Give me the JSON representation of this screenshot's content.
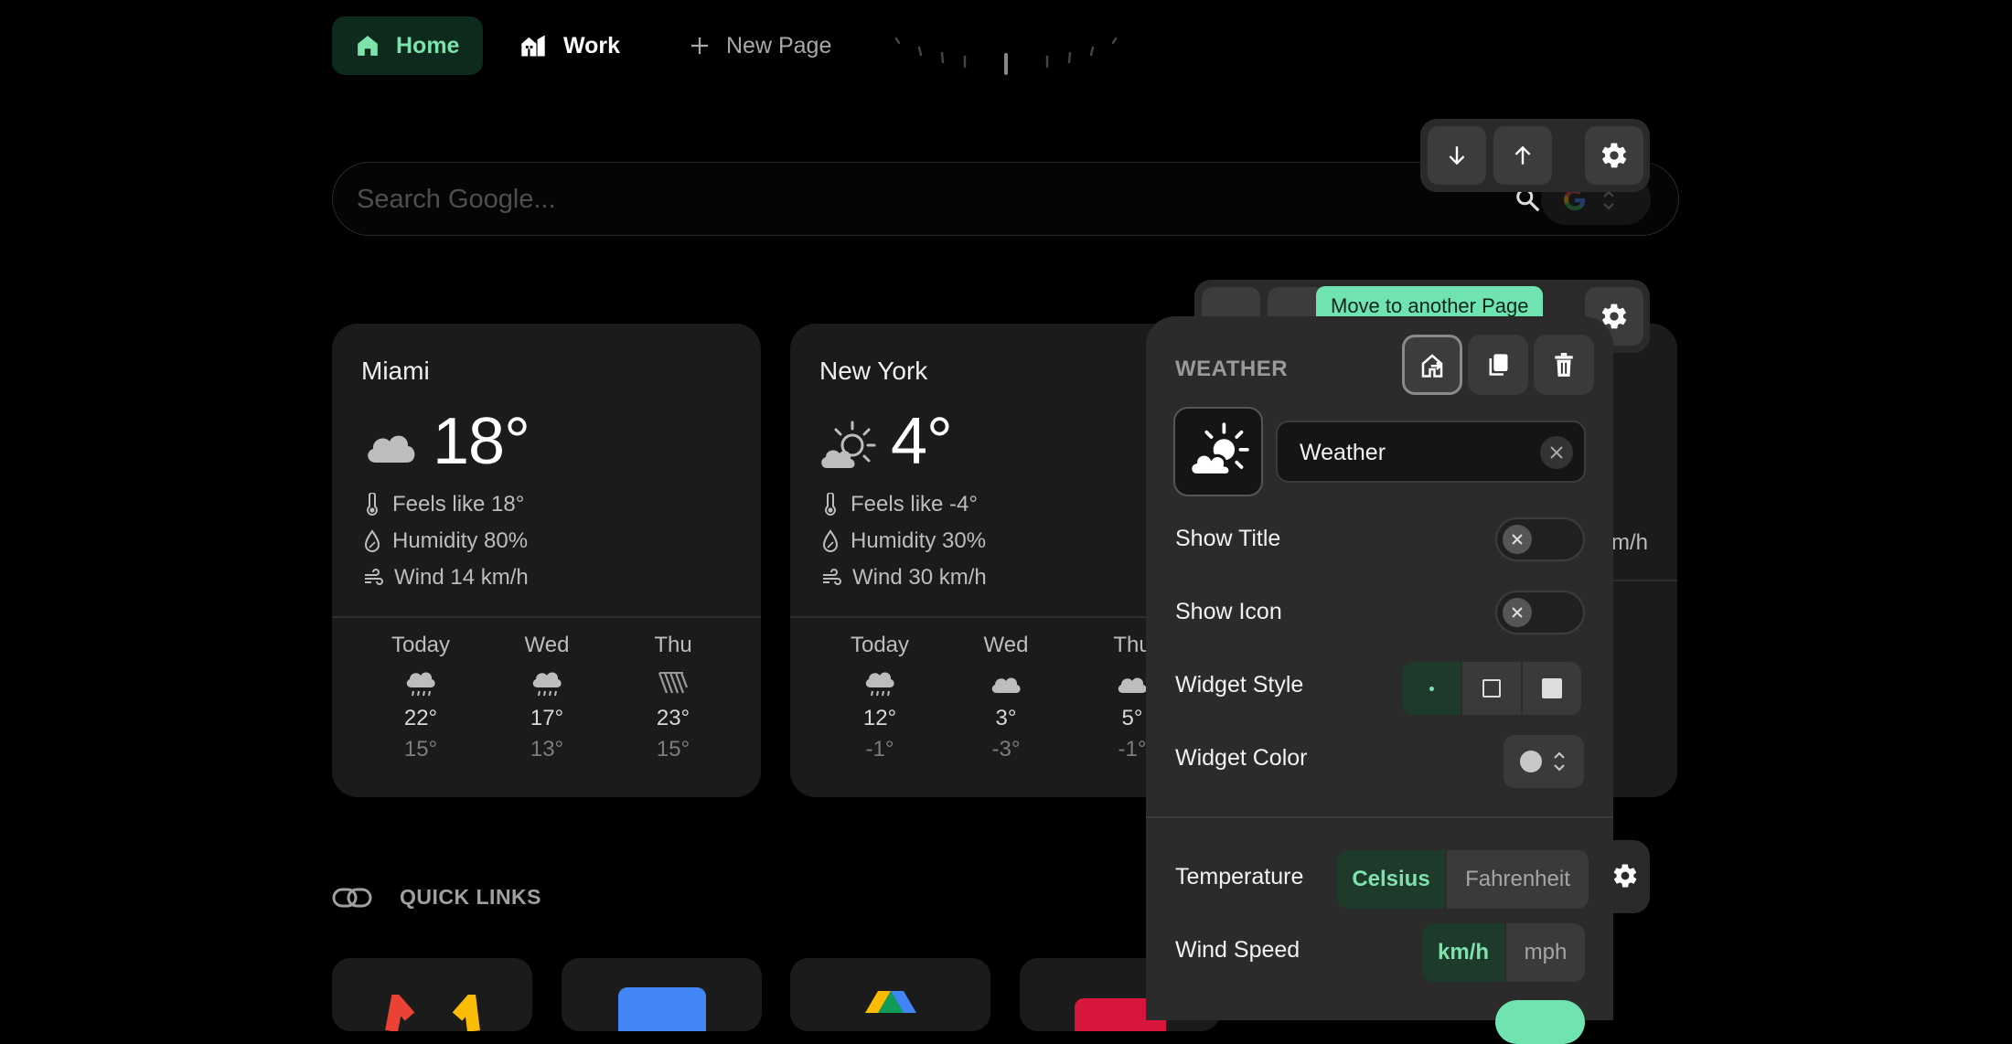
{
  "nav": {
    "tabs": [
      {
        "label": "Home",
        "icon": "home-icon"
      },
      {
        "label": "Work",
        "icon": "building-icon"
      },
      {
        "label": "New Page",
        "icon": "plus-icon"
      }
    ]
  },
  "search": {
    "placeholder": "Search Google..."
  },
  "weather_cards": [
    {
      "city": "Miami",
      "temp": "18°",
      "condition_icon": "cloud-icon",
      "feels_like": "Feels like 18°",
      "humidity": "Humidity 80%",
      "wind": "Wind 14 km/h",
      "forecast": [
        {
          "day": "Today",
          "icon": "rain-icon",
          "high": "22°",
          "low": "15°"
        },
        {
          "day": "Wed",
          "icon": "rain-icon",
          "high": "17°",
          "low": "13°"
        },
        {
          "day": "Thu",
          "icon": "heavy-rain-icon",
          "high": "23°",
          "low": "15°"
        }
      ]
    },
    {
      "city": "New York",
      "temp": "4°",
      "condition_icon": "partly-sunny-icon",
      "feels_like": "Feels like -4°",
      "humidity": "Humidity 30%",
      "wind": "Wind 30 km/h",
      "forecast": [
        {
          "day": "Today",
          "icon": "rain-icon",
          "high": "12°",
          "low": "-1°"
        },
        {
          "day": "Wed",
          "icon": "cloud-icon",
          "high": "3°",
          "low": "-3°"
        },
        {
          "day": "Thu",
          "icon": "cloud-icon",
          "high": "5°",
          "low": "-1°"
        }
      ]
    }
  ],
  "hidden_card": {
    "wind_fragment": "m/h"
  },
  "tooltip": "Move to another Page",
  "panel": {
    "title": "WEATHER",
    "name_value": "Weather",
    "show_title": "Show Title",
    "show_icon": "Show Icon",
    "widget_style": "Widget Style",
    "widget_color": "Widget Color",
    "temperature": "Temperature",
    "temp_options": [
      "Celsius",
      "Fahrenheit"
    ],
    "temp_selected": "Celsius",
    "wind_speed": "Wind Speed",
    "wind_options": [
      "km/h",
      "mph"
    ],
    "wind_selected": "km/h"
  },
  "quick_links": {
    "title": "QUICK LINKS"
  },
  "colors": {
    "accent": "#7ee2ad",
    "accent_bg": "#0e2a1d",
    "tooltip": "#6fe3b0"
  }
}
